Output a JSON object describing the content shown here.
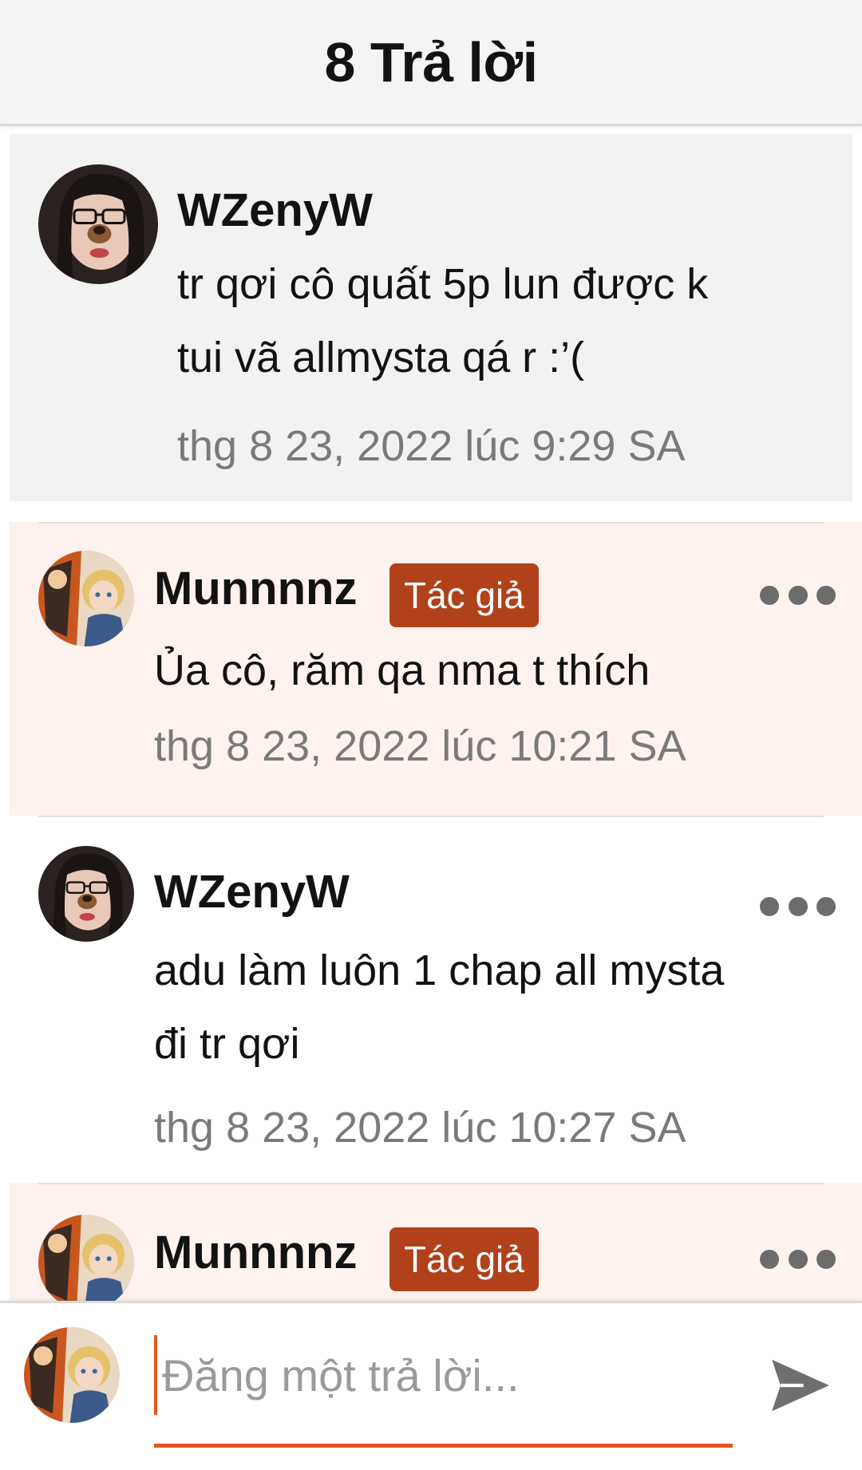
{
  "header": {
    "title": "8 Trả lời"
  },
  "comments": [
    {
      "username": "WZenyW",
      "text": "tr qơi cô quất 5p lun được k\ntui vã allmysta qá r :’(",
      "timestamp": "thg 8 23, 2022 lúc 9:29 SA",
      "highlighted": true,
      "background": "#f2f2f2"
    },
    {
      "username": "Munnnnz",
      "badge": "Tác giả",
      "text": "Ủa cô, răm qa nma t thích",
      "timestamp": "thg 8 23, 2022 lúc 10:21 SA",
      "background": "#fdf2ee"
    },
    {
      "username": "WZenyW",
      "text": "adu làm luôn 1 chap all mysta\nđi tr qơi",
      "timestamp": "thg 8 23, 2022 lúc 10:27 SA",
      "background": "#ffffff"
    },
    {
      "username": "Munnnnz",
      "badge": "Tác giả",
      "background": "#fdf2ee"
    }
  ],
  "composer": {
    "placeholder": "Đăng một trả lời..."
  },
  "colors": {
    "accent": "#e0571e",
    "badge": "#b1411a",
    "muted_text": "#7a7a7a"
  },
  "icons": {
    "more": "more-horizontal-icon",
    "send": "send-icon"
  }
}
